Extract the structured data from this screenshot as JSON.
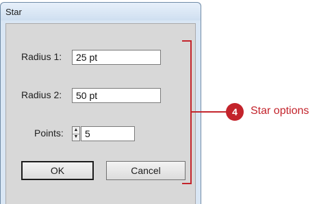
{
  "dialog": {
    "title": "Star",
    "radius1": {
      "label": "Radius 1:",
      "value": "25 pt"
    },
    "radius2": {
      "label": "Radius 2:",
      "value": "50 pt"
    },
    "points": {
      "label": "Points:",
      "value": "5"
    },
    "ok_label": "OK",
    "cancel_label": "Cancel"
  },
  "callout": {
    "number": "4",
    "text": "Star options",
    "color": "#c3232b"
  }
}
